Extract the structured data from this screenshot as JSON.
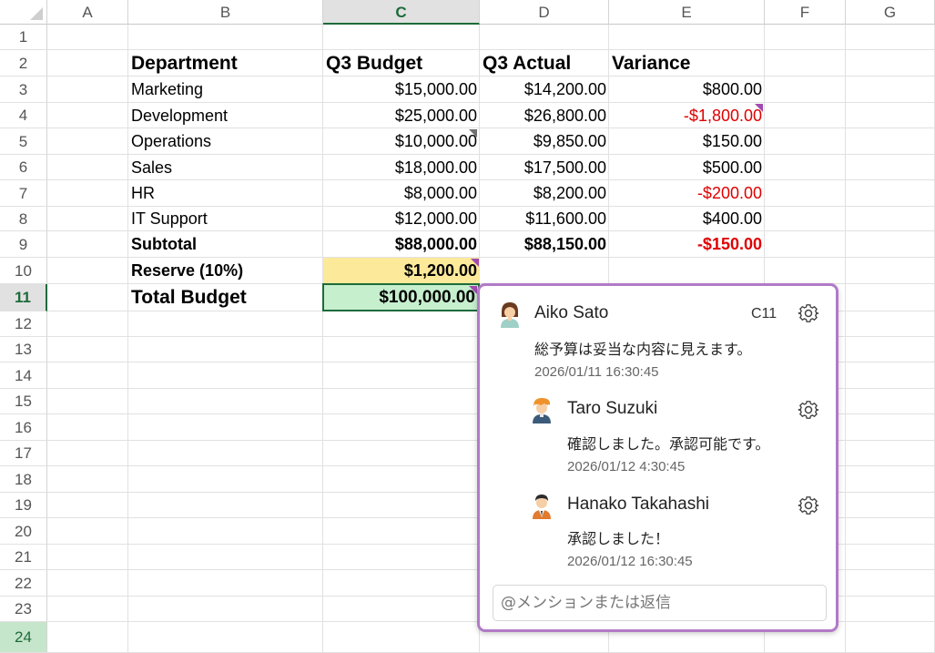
{
  "columns": [
    "A",
    "B",
    "C",
    "D",
    "E",
    "F",
    "G"
  ],
  "rows": [
    "1",
    "2",
    "3",
    "4",
    "5",
    "6",
    "7",
    "8",
    "9",
    "10",
    "11",
    "12",
    "13",
    "14",
    "15",
    "16",
    "17",
    "18",
    "19",
    "20",
    "21",
    "22",
    "23",
    "24"
  ],
  "headers": {
    "department": "Department",
    "budget": "Q3 Budget",
    "actual": "Q3 Actual",
    "variance": "Variance"
  },
  "data_rows": [
    {
      "department": "Marketing",
      "budget": "$15,000.00",
      "actual": "$14,200.00",
      "variance": "$800.00"
    },
    {
      "department": "Development",
      "budget": "$25,000.00",
      "actual": "$26,800.00",
      "variance": "-$1,800.00"
    },
    {
      "department": "Operations",
      "budget": "$10,000.00",
      "actual": "$9,850.00",
      "variance": "$150.00"
    },
    {
      "department": "Sales",
      "budget": "$18,000.00",
      "actual": "$17,500.00",
      "variance": "$500.00"
    },
    {
      "department": "HR",
      "budget": "$8,000.00",
      "actual": "$8,200.00",
      "variance": "-$200.00"
    },
    {
      "department": "IT Support",
      "budget": "$12,000.00",
      "actual": "$11,600.00",
      "variance": "$400.00"
    }
  ],
  "subtotal": {
    "label": "Subtotal",
    "budget": "$88,000.00",
    "actual": "$88,150.00",
    "variance": "-$150.00"
  },
  "reserve": {
    "label": "Reserve (10%)",
    "budget": "$1,200.00"
  },
  "total": {
    "label": "Total Budget",
    "budget": "$100,000.00"
  },
  "colors": {
    "selected": "#1e6b3a",
    "reserve_fill": "#fce99a",
    "total_fill": "#c6efce",
    "negative": "#e00000",
    "comment_border": "#b17ac6",
    "comment_marker": "#a24ab0"
  },
  "comments": {
    "cell_ref": "C11",
    "thread": [
      {
        "author": "Aiko Sato",
        "text": "総予算は妥当な内容に見えます。",
        "date": "2026/01/11 16:30:45",
        "avatar": "avatar-woman-icon"
      },
      {
        "author": "Taro Suzuki",
        "text": "確認しました。承認可能です。",
        "date": "2026/01/12 4:30:45",
        "avatar": "avatar-man-orange-hair-icon"
      },
      {
        "author": "Hanako Takahashi",
        "text": "承認しました！",
        "date": "2026/01/12 16:30:45",
        "avatar": "avatar-man-tie-icon"
      }
    ],
    "reply_placeholder": "@メンションまたは返信"
  }
}
